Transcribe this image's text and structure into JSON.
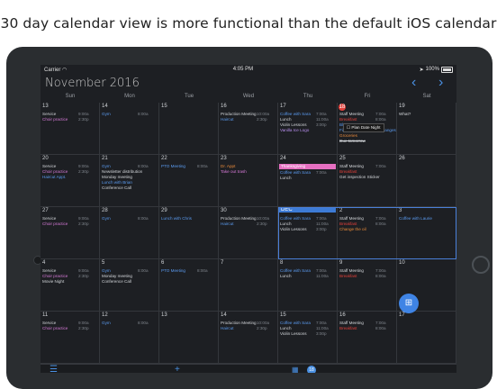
{
  "caption": "30 day calendar view is more functional than the default iOS calendar",
  "statusbar": {
    "carrier": "Carrier",
    "time": "4:05 PM",
    "battery": "100%"
  },
  "header": {
    "month": "November 2016"
  },
  "weekdays": [
    "Sun",
    "Mon",
    "Tue",
    "Wed",
    "Thu",
    "Fri",
    "Sat"
  ],
  "weeks": [
    {
      "days": [
        {
          "num": "13",
          "events": [
            {
              "title": "Service",
              "time": "9:00a",
              "cls": ""
            },
            {
              "title": "Choir practice",
              "time": "2:30p",
              "cls": "tl-pink"
            }
          ]
        },
        {
          "num": "14",
          "events": [
            {
              "title": "Gym",
              "time": "8:00a",
              "cls": "tl-blue"
            }
          ]
        },
        {
          "num": "15",
          "events": []
        },
        {
          "num": "16",
          "events": [
            {
              "title": "Production Meeting",
              "time": "10:00a",
              "cls": ""
            },
            {
              "title": "Haircut",
              "time": "2:30p",
              "cls": "tl-blue"
            }
          ]
        },
        {
          "num": "17",
          "events": [
            {
              "title": "Coffee with Sara",
              "time": "7:00a",
              "cls": "tl-blue"
            },
            {
              "title": "Lunch",
              "time": "11:00a",
              "cls": ""
            },
            {
              "title": "Violin Lessons",
              "time": "3:00p",
              "cls": ""
            },
            {
              "title": "Vanilla Ice Logo",
              "time": "",
              "cls": "tl-purple"
            }
          ]
        },
        {
          "num": "18",
          "today": true,
          "events": [
            {
              "title": "Staff Meeting",
              "time": "7:00a",
              "cls": ""
            },
            {
              "title": "Breakfast",
              "time": "8:00a",
              "cls": "tl-red"
            },
            {
              "title": "Blog Post",
              "time": "",
              "cls": "tl-blue"
            },
            {
              "title": "Finalize major feature changes",
              "time": "",
              "cls": "tl-blue"
            },
            {
              "title": "Groceries",
              "time": "",
              "cls": "tl-orange"
            },
            {
              "title": "Due tomorrow",
              "time": "",
              "cls": "strike"
            }
          ]
        },
        {
          "num": "19",
          "events": [
            {
              "title": "What?",
              "time": "",
              "cls": ""
            }
          ]
        }
      ]
    },
    {
      "days": [
        {
          "num": "20",
          "events": [
            {
              "title": "Service",
              "time": "9:00a",
              "cls": ""
            },
            {
              "title": "Choir practice",
              "time": "2:30p",
              "cls": "tl-pink"
            },
            {
              "title": "Haircut Appt.",
              "time": "",
              "cls": "tl-blue"
            }
          ]
        },
        {
          "num": "21",
          "events": [
            {
              "title": "Gym",
              "time": "8:00a",
              "cls": "tl-blue"
            },
            {
              "title": "Newsletter distribution",
              "time": "",
              "cls": ""
            },
            {
              "title": "Monday meeting",
              "time": "",
              "cls": ""
            },
            {
              "title": "Lunch with Brian",
              "time": "",
              "cls": "tl-blue"
            },
            {
              "title": "Conference Call",
              "time": "",
              "cls": ""
            }
          ]
        },
        {
          "num": "22",
          "events": [
            {
              "title": "PTO Meeting",
              "time": "8:00a",
              "cls": "tl-blue"
            }
          ]
        },
        {
          "num": "23",
          "events": [
            {
              "title": "Dr. Appt",
              "time": "",
              "cls": "tl-orange"
            },
            {
              "title": "Take out trash",
              "time": "",
              "cls": "tl-pink"
            }
          ]
        },
        {
          "num": "24",
          "events": [
            {
              "title": "Thanksgiving",
              "time": "",
              "cls": "bar-pink"
            },
            {
              "title": "Coffee with Sara",
              "time": "7:00a",
              "cls": "tl-blue"
            },
            {
              "title": "Lunch",
              "time": "",
              "cls": ""
            }
          ]
        },
        {
          "num": "25",
          "events": [
            {
              "title": "Staff Meeting",
              "time": "7:00a",
              "cls": ""
            },
            {
              "title": "Breakfast",
              "time": "",
              "cls": "tl-red"
            },
            {
              "title": "Get inspection Sticker",
              "time": "",
              "cls": ""
            }
          ]
        },
        {
          "num": "26",
          "events": []
        }
      ]
    },
    {
      "days": [
        {
          "num": "27",
          "events": [
            {
              "title": "Service",
              "time": "9:00a",
              "cls": ""
            },
            {
              "title": "Choir practice",
              "time": "2:30p",
              "cls": "tl-pink"
            }
          ]
        },
        {
          "num": "28",
          "events": [
            {
              "title": "Gym",
              "time": "8:00a",
              "cls": "tl-blue"
            }
          ]
        },
        {
          "num": "29",
          "events": [
            {
              "title": "Lunch with Chris",
              "time": "",
              "cls": "tl-blue"
            }
          ]
        },
        {
          "num": "30",
          "events": [
            {
              "title": "Production Meeting",
              "time": "10:00a",
              "cls": ""
            },
            {
              "title": "Haircut",
              "time": "2:30p",
              "cls": "tl-blue"
            }
          ]
        },
        {
          "num": "DEC",
          "events": [
            {
              "title": "Coffee with Sara",
              "time": "7:00a",
              "cls": "tl-blue"
            },
            {
              "title": "Lunch",
              "time": "11:00a",
              "cls": ""
            },
            {
              "title": "Violin Lessons",
              "time": "3:00p",
              "cls": ""
            }
          ]
        },
        {
          "num": "2",
          "events": [
            {
              "title": "Staff Meeting",
              "time": "7:00a",
              "cls": ""
            },
            {
              "title": "Breakfast",
              "time": "8:00a",
              "cls": "tl-red"
            },
            {
              "title": "Change the oil",
              "time": "",
              "cls": "tl-orange"
            }
          ]
        },
        {
          "num": "3",
          "events": [
            {
              "title": "Coffee with Laurie",
              "time": "",
              "cls": "tl-blue"
            }
          ]
        }
      ]
    },
    {
      "days": [
        {
          "num": "4",
          "events": [
            {
              "title": "Service",
              "time": "9:00a",
              "cls": ""
            },
            {
              "title": "Choir practice",
              "time": "2:30p",
              "cls": "tl-pink"
            },
            {
              "title": "Movie Night",
              "time": "",
              "cls": ""
            }
          ]
        },
        {
          "num": "5",
          "events": [
            {
              "title": "Gym",
              "time": "8:00a",
              "cls": "tl-blue"
            },
            {
              "title": "Monday meeting",
              "time": "",
              "cls": ""
            },
            {
              "title": "Conference Call",
              "time": "",
              "cls": ""
            }
          ]
        },
        {
          "num": "6",
          "events": [
            {
              "title": "PTO Meeting",
              "time": "8:00a",
              "cls": "tl-blue"
            }
          ]
        },
        {
          "num": "7",
          "events": []
        },
        {
          "num": "8",
          "events": [
            {
              "title": "Coffee with Sara",
              "time": "7:00a",
              "cls": "tl-blue"
            },
            {
              "title": "Lunch",
              "time": "11:00a",
              "cls": ""
            }
          ]
        },
        {
          "num": "9",
          "events": [
            {
              "title": "Staff Meeting",
              "time": "7:00a",
              "cls": ""
            },
            {
              "title": "Breakfast",
              "time": "8:00a",
              "cls": "tl-red"
            }
          ]
        },
        {
          "num": "10",
          "events": []
        }
      ]
    },
    {
      "days": [
        {
          "num": "11",
          "events": [
            {
              "title": "Service",
              "time": "9:00a",
              "cls": ""
            },
            {
              "title": "Choir practice",
              "time": "2:30p",
              "cls": "tl-pink"
            }
          ]
        },
        {
          "num": "12",
          "events": [
            {
              "title": "Gym",
              "time": "8:00a",
              "cls": "tl-blue"
            }
          ]
        },
        {
          "num": "13",
          "events": []
        },
        {
          "num": "14",
          "events": [
            {
              "title": "Production Meeting",
              "time": "10:00a",
              "cls": ""
            },
            {
              "title": "Haircut",
              "time": "2:30p",
              "cls": "tl-blue"
            }
          ]
        },
        {
          "num": "15",
          "events": [
            {
              "title": "Coffee with Sara",
              "time": "7:00a",
              "cls": "tl-blue"
            },
            {
              "title": "Lunch",
              "time": "11:00a",
              "cls": ""
            },
            {
              "title": "Violin Lessons",
              "time": "3:00p",
              "cls": ""
            }
          ]
        },
        {
          "num": "16",
          "events": [
            {
              "title": "Staff Meeting",
              "time": "7:00a",
              "cls": ""
            },
            {
              "title": "Breakfast",
              "time": "8:00a",
              "cls": "tl-red"
            }
          ]
        },
        {
          "num": "17",
          "events": []
        }
      ]
    }
  ],
  "popup": {
    "title": "Plan Date Night"
  },
  "toolbar": {
    "today_badge": "18"
  },
  "colors": {
    "accent": "#4a90e2",
    "today": "#e0403a",
    "holiday": "#e66fc1"
  }
}
